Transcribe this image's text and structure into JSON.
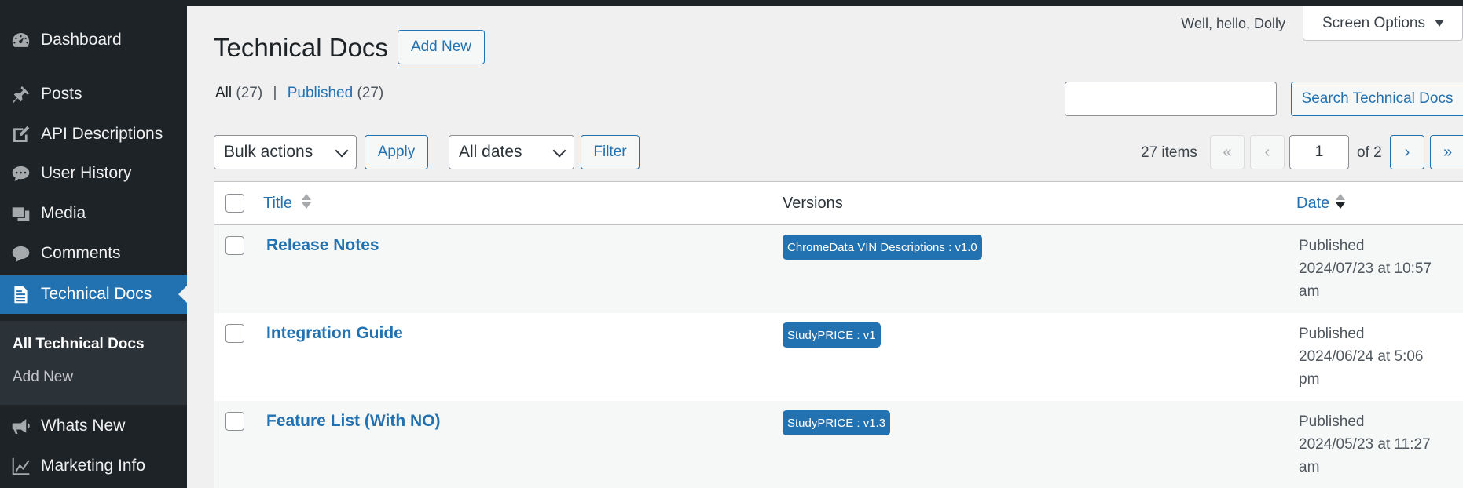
{
  "sidebar": {
    "items": [
      {
        "label": "Dashboard",
        "icon": "dashboard-icon"
      },
      {
        "label": "Posts",
        "icon": "pin-icon"
      },
      {
        "label": "API Descriptions",
        "icon": "edit-icon"
      },
      {
        "label": "User History",
        "icon": "chat-icon"
      },
      {
        "label": "Media",
        "icon": "media-icon"
      },
      {
        "label": "Comments",
        "icon": "comment-icon"
      },
      {
        "label": "Technical Docs",
        "icon": "document-icon"
      },
      {
        "label": "Whats New",
        "icon": "megaphone-icon"
      },
      {
        "label": "Marketing Info",
        "icon": "chart-line-icon"
      }
    ],
    "submenu": [
      "All Technical Docs",
      "Add New"
    ]
  },
  "header": {
    "greeting": "Well, hello, Dolly",
    "screen_options": "Screen Options",
    "title": "Technical Docs",
    "add_new": "Add New"
  },
  "filters": {
    "all_label": "All",
    "all_count": "(27)",
    "published_label": "Published",
    "published_count": "(27)",
    "separator": "|",
    "search_button": "Search Technical Docs",
    "search_value": "",
    "bulk_actions": "Bulk actions",
    "apply": "Apply",
    "dates": "All dates",
    "filter": "Filter"
  },
  "pagination": {
    "items": "27 items",
    "first": "«",
    "prev": "‹",
    "current": "1",
    "of": "of 2",
    "next": "›",
    "last": "»"
  },
  "table": {
    "columns": {
      "title": "Title",
      "versions": "Versions",
      "date": "Date"
    },
    "rows": [
      {
        "title": "Release Notes",
        "version": "ChromeData VIN Descriptions : v1.0",
        "status": "Published",
        "date": "2024/07/23 at 10:57",
        "ampm": "am"
      },
      {
        "title": "Integration Guide",
        "version": "StudyPRICE : v1",
        "status": "Published",
        "date": "2024/06/24 at 5:06",
        "ampm": "pm"
      },
      {
        "title": "Feature List (With NO)",
        "version": "StudyPRICE : v1.3",
        "status": "Published",
        "date": "2024/05/23 at 11:27",
        "ampm": "am"
      }
    ]
  },
  "colors": {
    "sidebar_bg": "#1d2327",
    "accent": "#2271b1",
    "page_bg": "#f0f0f1"
  }
}
